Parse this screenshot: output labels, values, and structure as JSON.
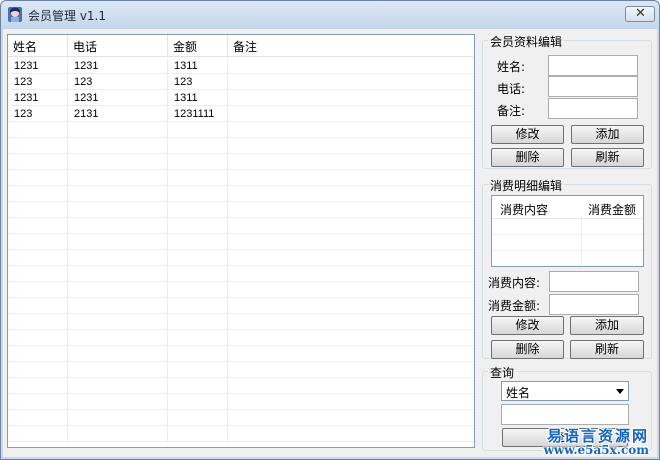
{
  "window": {
    "title": "会员管理 v1.1"
  },
  "table": {
    "columns": [
      "姓名",
      "电话",
      "金额",
      "备注"
    ],
    "rows": [
      [
        "1231",
        "1231",
        "1311",
        ""
      ],
      [
        "123",
        "123",
        "123",
        ""
      ],
      [
        "1231",
        "1231",
        "1311",
        ""
      ],
      [
        "123",
        "2131",
        "1231111",
        ""
      ]
    ]
  },
  "member_edit": {
    "title": "会员资料编辑",
    "name_label": "姓名:",
    "phone_label": "电话:",
    "note_label": "备注:",
    "name_value": "",
    "phone_value": "",
    "note_value": "",
    "modify": "修改",
    "add": "添加",
    "delete": "删除",
    "refresh": "刷新"
  },
  "consume_edit": {
    "title": "消费明细编辑",
    "columns": [
      "消费内容",
      "消费金额"
    ],
    "content_label": "消费内容:",
    "amount_label": "消费金额:",
    "content_value": "",
    "amount_value": "",
    "modify": "修改",
    "add": "添加",
    "delete": "删除",
    "refresh": "刷新"
  },
  "query": {
    "title": "查询",
    "field_selected": "姓名",
    "keyword_value": "",
    "button": "查询"
  },
  "watermark": {
    "line1": "易语言资源网",
    "line2": "www.e5a5x.com"
  }
}
